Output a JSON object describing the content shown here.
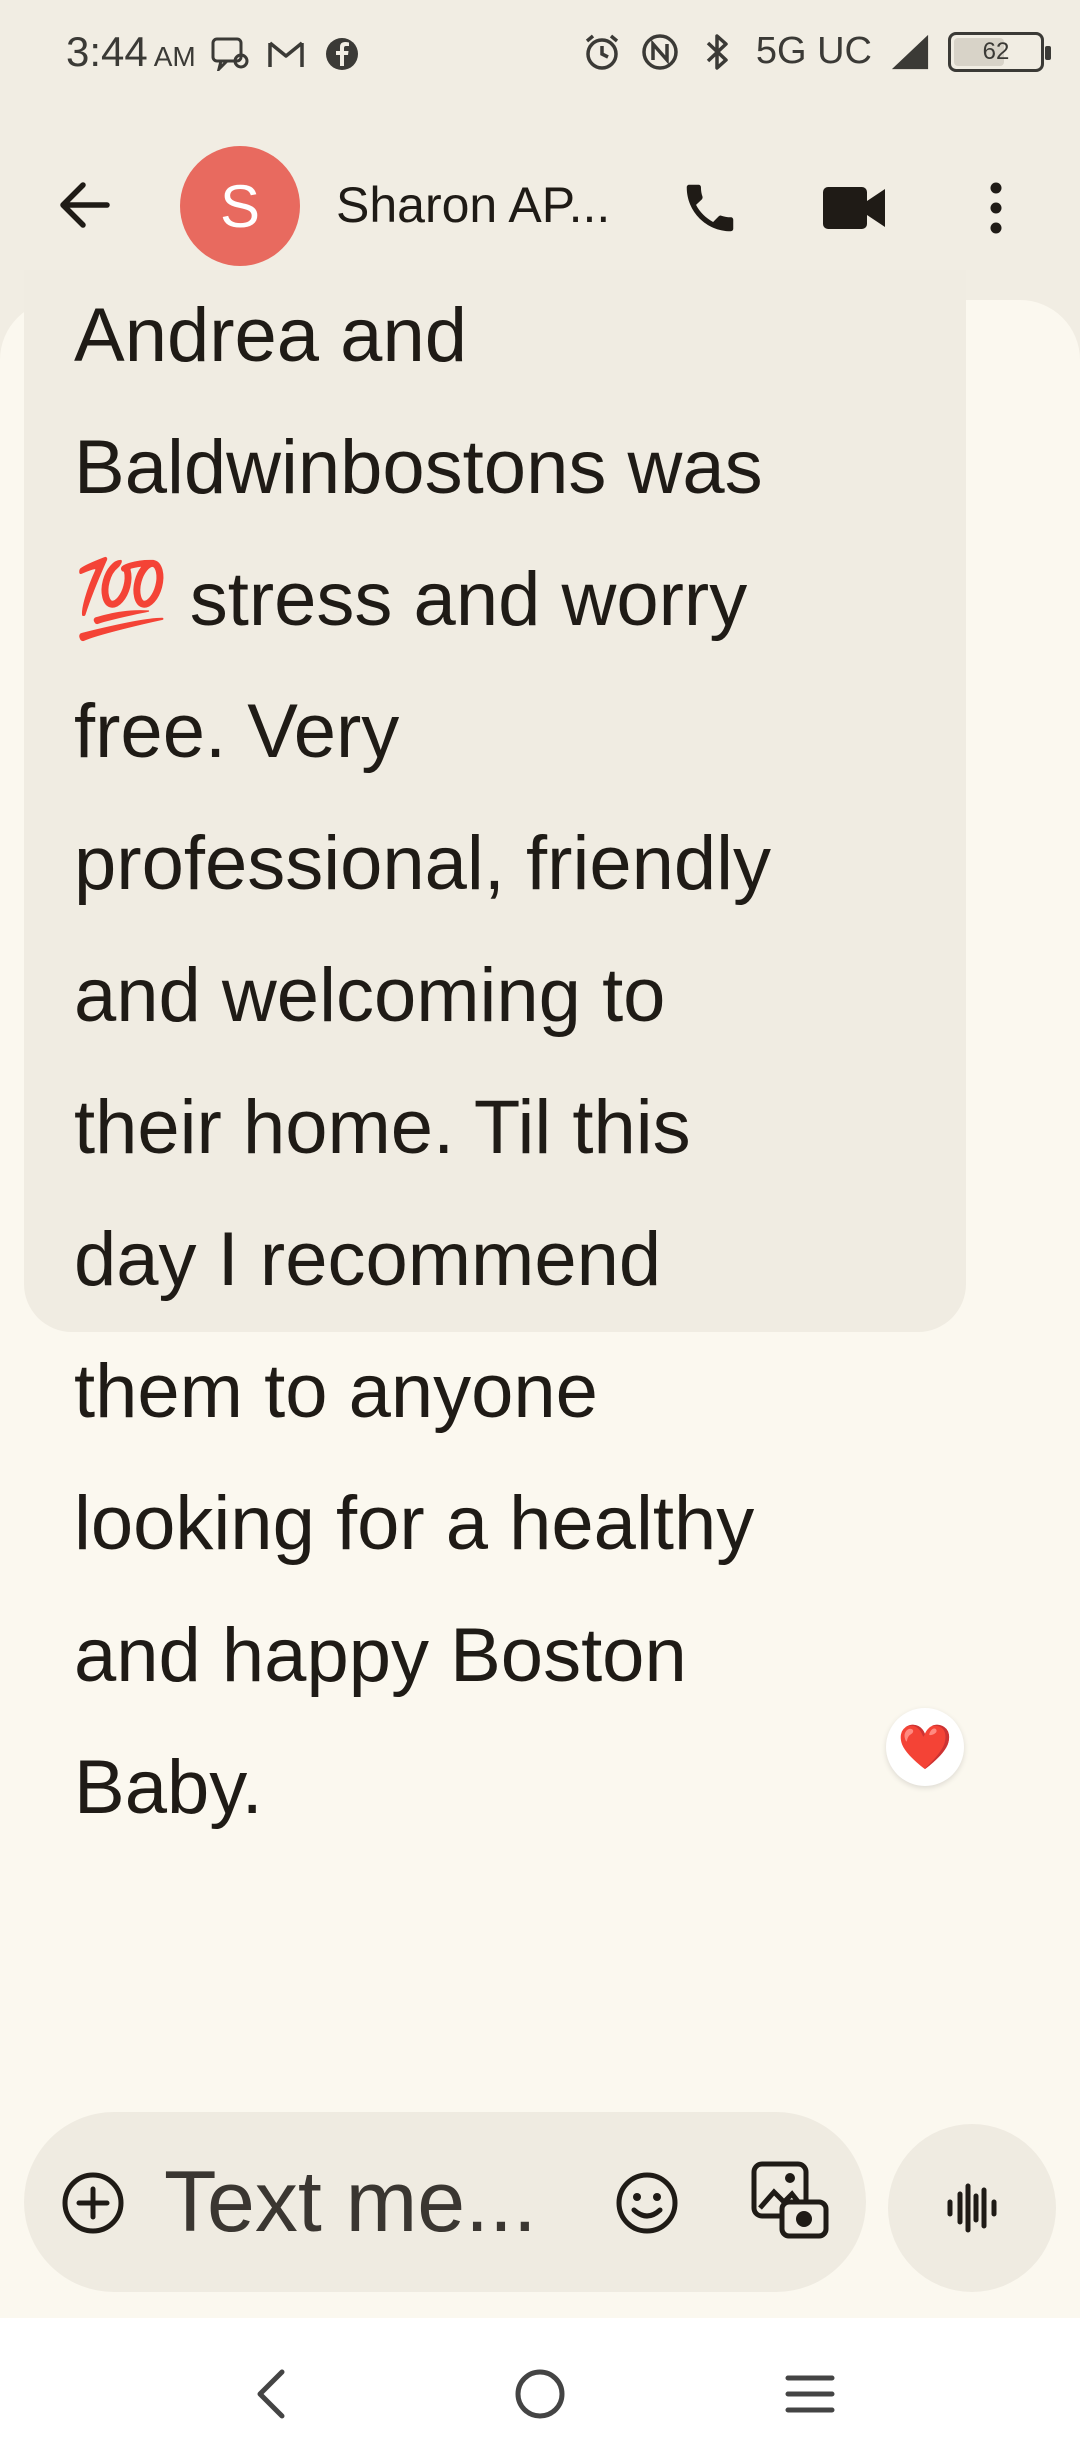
{
  "status_bar": {
    "time": "3:44",
    "ampm": "AM",
    "network": "5G UC",
    "battery": "62",
    "battery_level": 62
  },
  "header": {
    "avatar_letter": "S",
    "contact_name": "Sharon AP...",
    "avatar_color": "#e86a5f"
  },
  "message": {
    "text_lines": [
      "Andrea and",
      "Baldwinbostons was",
      "💯 stress and worry",
      "free. Very",
      "professional, friendly",
      "and welcoming to",
      "their home. Til this",
      "day I recommend",
      "them to anyone",
      "looking for a healthy",
      "and happy Boston",
      "Baby."
    ],
    "reaction": "❤️"
  },
  "compose": {
    "placeholder": "Text me..."
  },
  "icons": {
    "back": "arrow-left-icon",
    "call": "phone-icon",
    "video": "video-camera-icon",
    "more": "more-vert-icon",
    "add": "plus-circle-icon",
    "emoji": "emoji-icon",
    "media": "gallery-icon",
    "voice": "waveform-icon"
  }
}
